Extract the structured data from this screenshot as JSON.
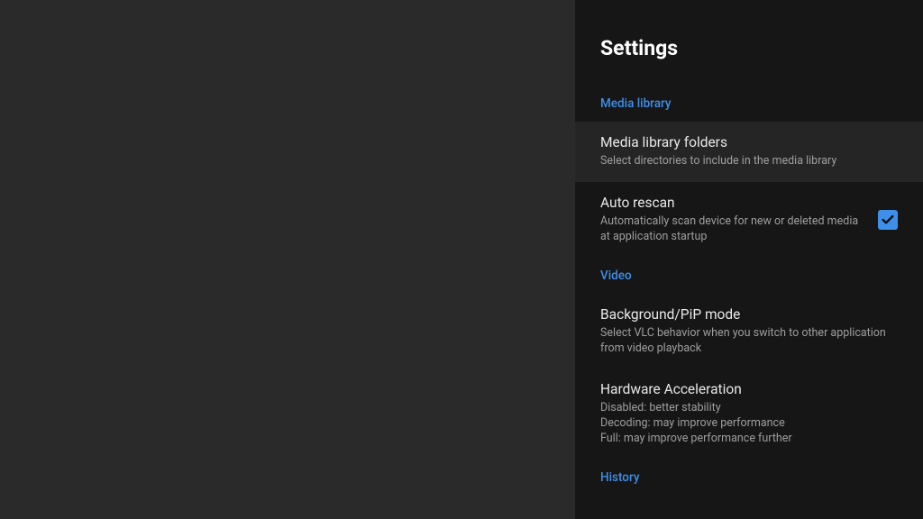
{
  "panel": {
    "title": "Settings",
    "sections": {
      "media_library": {
        "header": "Media library",
        "items": {
          "folders": {
            "title": "Media library folders",
            "description": "Select directories to include in the media library"
          },
          "auto_rescan": {
            "title": "Auto rescan",
            "description": "Automatically scan device for new or deleted media at application startup",
            "checked": true
          }
        }
      },
      "video": {
        "header": "Video",
        "items": {
          "pip_mode": {
            "title": "Background/PiP mode",
            "description": "Select VLC behavior when you switch to other application from video playback"
          },
          "hw_accel": {
            "title": "Hardware Acceleration",
            "description": "Disabled: better stability\nDecoding: may improve performance\nFull: may improve performance further"
          }
        }
      },
      "history": {
        "header": "History"
      }
    }
  }
}
